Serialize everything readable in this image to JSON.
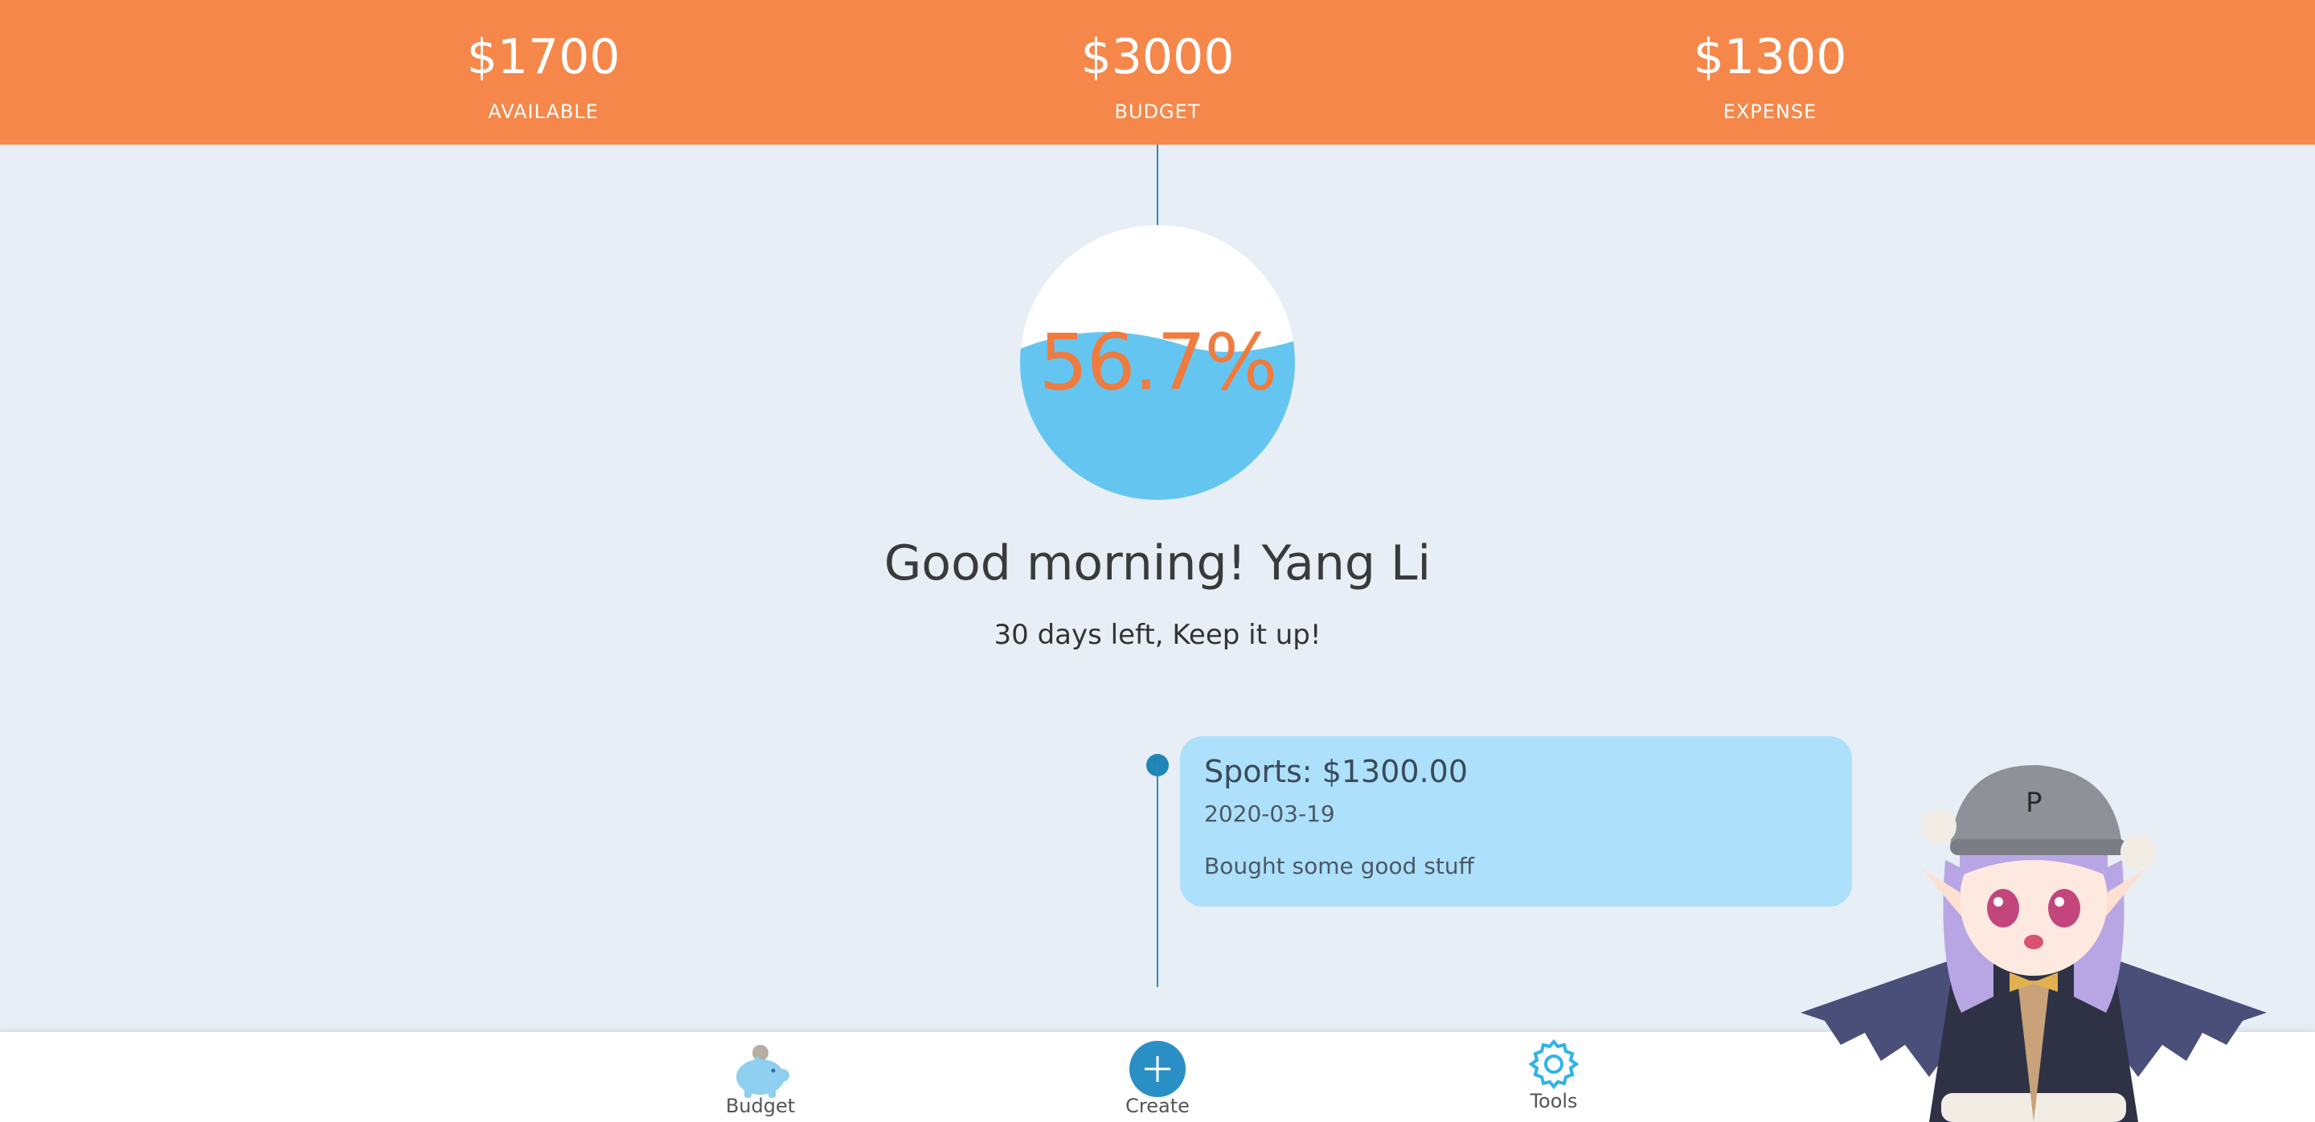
{
  "stats": {
    "available": {
      "amount": "$1700",
      "label": "AVAILABLE"
    },
    "budget": {
      "amount": "$3000",
      "label": "BUDGET"
    },
    "expense": {
      "amount": "$1300",
      "label": "EXPENSE"
    }
  },
  "progress": {
    "percent_text": "56.7%",
    "fill_fraction": 0.567
  },
  "greeting": "Good morning! Yang Li",
  "subtitle": "30 days left, Keep it up!",
  "timeline": [
    {
      "title": "Sports: $1300.00",
      "date": "2020-03-19",
      "note": "Bought some good stuff"
    }
  ],
  "nav": {
    "budget": {
      "label": "Budget",
      "icon": "piggy-bank-icon"
    },
    "create": {
      "label": "Create",
      "icon": "plus-icon"
    },
    "tools": {
      "label": "Tools",
      "icon": "gear-icon"
    }
  },
  "colors": {
    "header": "#f5874a",
    "accent_blue": "#65c5f1",
    "card": "#ade0fb",
    "background": "#e7eef5",
    "percent_text": "#f07b3e"
  }
}
